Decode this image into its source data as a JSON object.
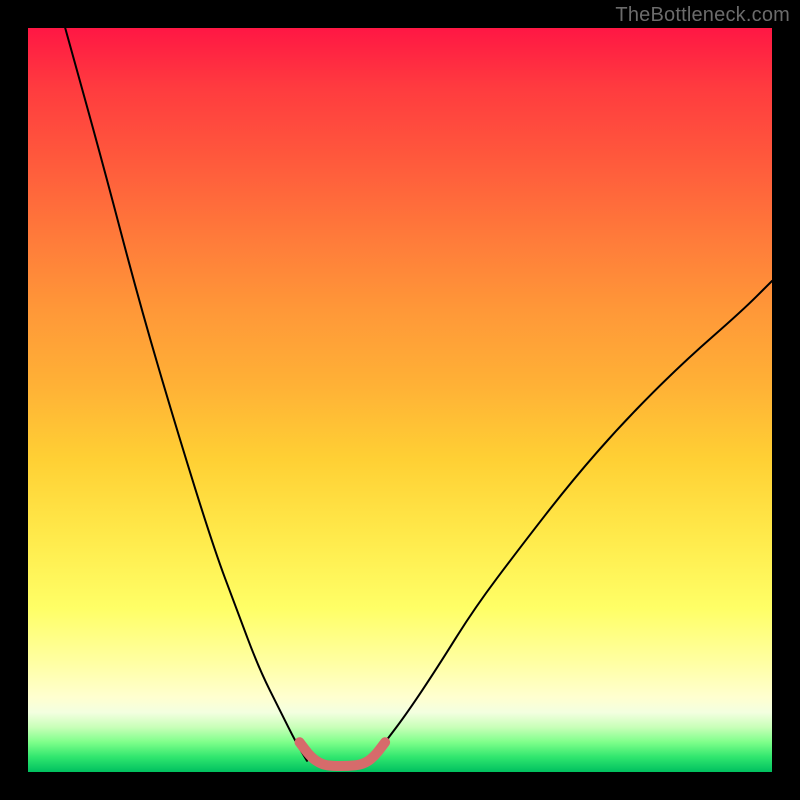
{
  "watermark": "TheBottleneck.com",
  "chart_data": {
    "type": "line",
    "title": "",
    "xlabel": "",
    "ylabel": "",
    "xlim": [
      0,
      100
    ],
    "ylim": [
      0,
      100
    ],
    "grid": false,
    "legend": false,
    "series": [
      {
        "name": "left-curve",
        "color": "#000000",
        "stroke_width": 2,
        "x": [
          5,
          10,
          15,
          20,
          25,
          28,
          31,
          34,
          36,
          37.5
        ],
        "y": [
          100,
          82,
          63,
          46,
          30,
          22,
          14,
          8,
          4,
          1.5
        ]
      },
      {
        "name": "right-curve",
        "color": "#000000",
        "stroke_width": 2,
        "x": [
          46,
          48,
          51,
          55,
          60,
          66,
          73,
          80,
          88,
          96,
          100
        ],
        "y": [
          1.5,
          4,
          8,
          14,
          22,
          30,
          39,
          47,
          55,
          62,
          66
        ]
      },
      {
        "name": "bottom-pink-segment",
        "color": "#d66b6b",
        "stroke_width": 10,
        "x": [
          36.5,
          38,
          39.5,
          41,
          43,
          45,
          46.5,
          48
        ],
        "y": [
          4,
          2,
          1,
          0.8,
          0.8,
          1,
          2,
          4
        ]
      }
    ],
    "gradient_stops": [
      {
        "pos": 0,
        "color": "#ff1744"
      },
      {
        "pos": 8,
        "color": "#ff3b3f"
      },
      {
        "pos": 18,
        "color": "#ff5a3c"
      },
      {
        "pos": 28,
        "color": "#ff7a3a"
      },
      {
        "pos": 38,
        "color": "#ff9838"
      },
      {
        "pos": 48,
        "color": "#ffb136"
      },
      {
        "pos": 58,
        "color": "#ffd034"
      },
      {
        "pos": 68,
        "color": "#ffe94a"
      },
      {
        "pos": 78,
        "color": "#ffff66"
      },
      {
        "pos": 85,
        "color": "#ffffa0"
      },
      {
        "pos": 90,
        "color": "#ffffd0"
      },
      {
        "pos": 92,
        "color": "#f3ffe0"
      },
      {
        "pos": 94,
        "color": "#c8ffb8"
      },
      {
        "pos": 96,
        "color": "#7eff8a"
      },
      {
        "pos": 98,
        "color": "#30e66e"
      },
      {
        "pos": 100,
        "color": "#00c060"
      }
    ]
  }
}
